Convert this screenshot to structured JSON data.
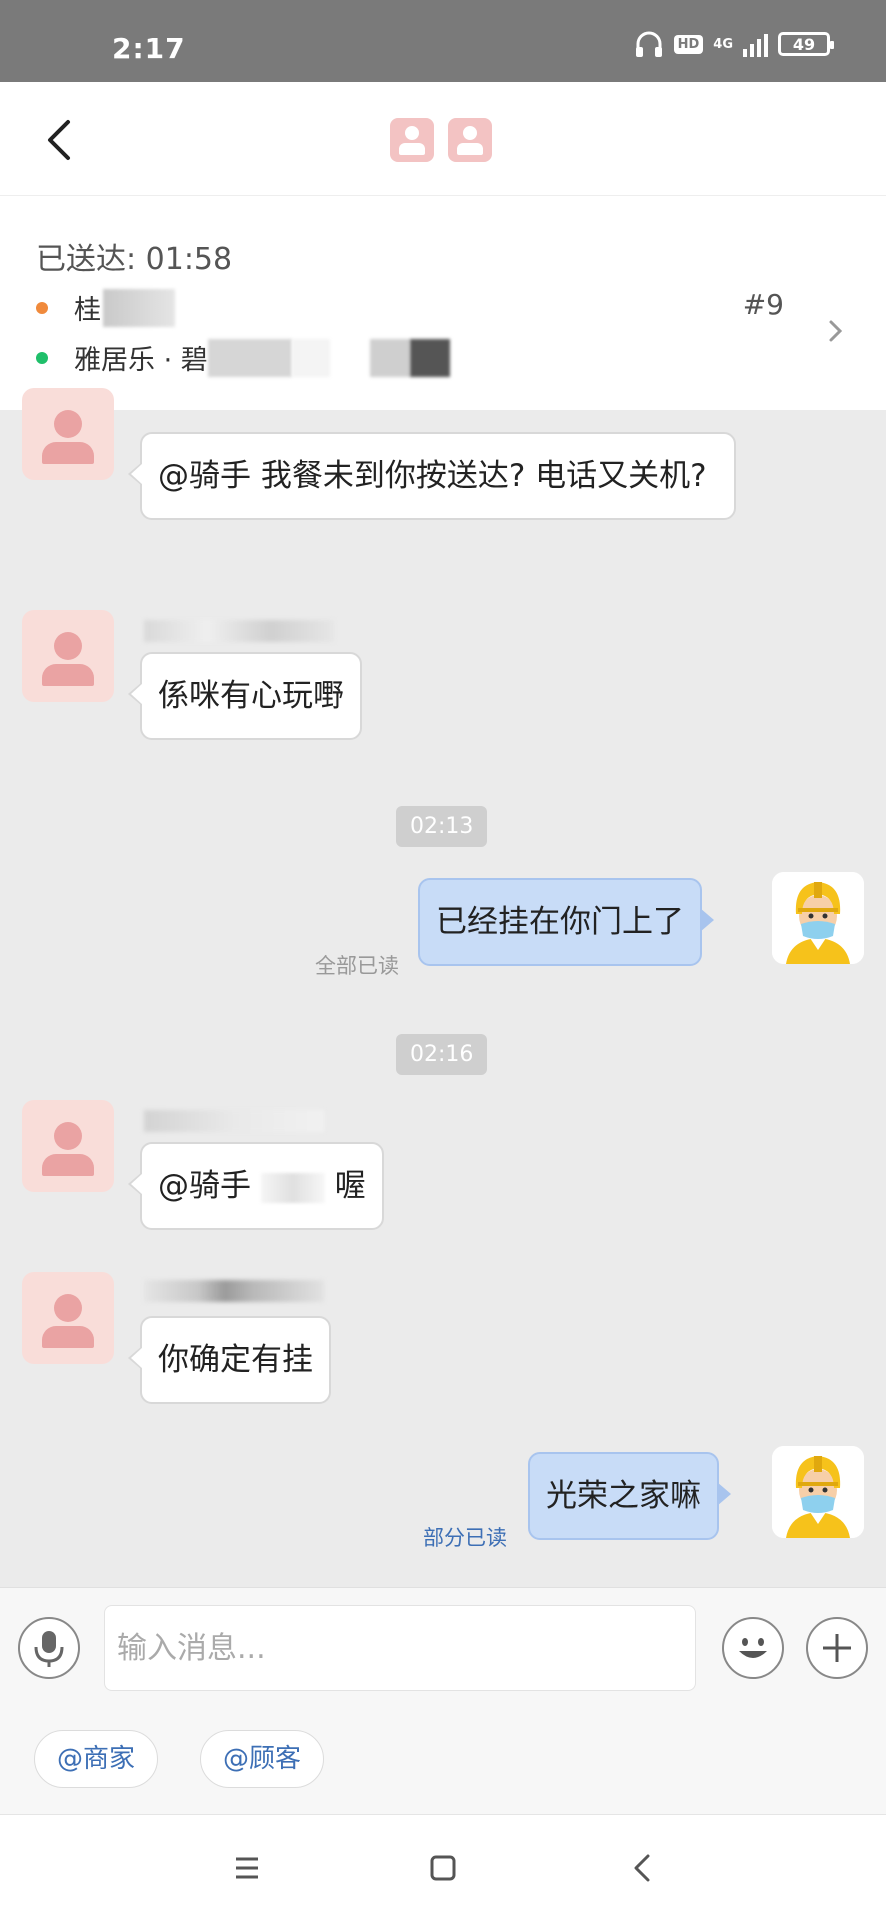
{
  "status_bar": {
    "time": "2:17",
    "hd": "HD",
    "network": "4G",
    "battery": "49"
  },
  "order": {
    "status": "已送达: 01:58",
    "line1": "桂",
    "line2": "雅居乐 · 碧",
    "number": "#9"
  },
  "messages": [
    {
      "side": "left",
      "text": "@骑手 我餐未到你按送达? 电话又关机?"
    },
    {
      "side": "left",
      "text": "係咪有心玩嘢"
    },
    {
      "time": "02:13"
    },
    {
      "side": "right",
      "text": "已经挂在你门上了",
      "read": "全部已读"
    },
    {
      "time": "02:16"
    },
    {
      "side": "left",
      "text_prefix": "@骑手",
      "text_suffix": "喔"
    },
    {
      "side": "left",
      "text": "你确定有挂"
    },
    {
      "side": "right",
      "text": "光荣之家嘛",
      "read": "部分已读"
    }
  ],
  "input": {
    "placeholder": "输入消息..."
  },
  "quick_replies": [
    "@商家",
    "@顾客"
  ],
  "colors": {
    "accent": "#3d6fb5",
    "bubble_self": "#c8dcf7",
    "avatar_bg": "#f9ddd9",
    "status_bar": "#7a7a7a"
  }
}
